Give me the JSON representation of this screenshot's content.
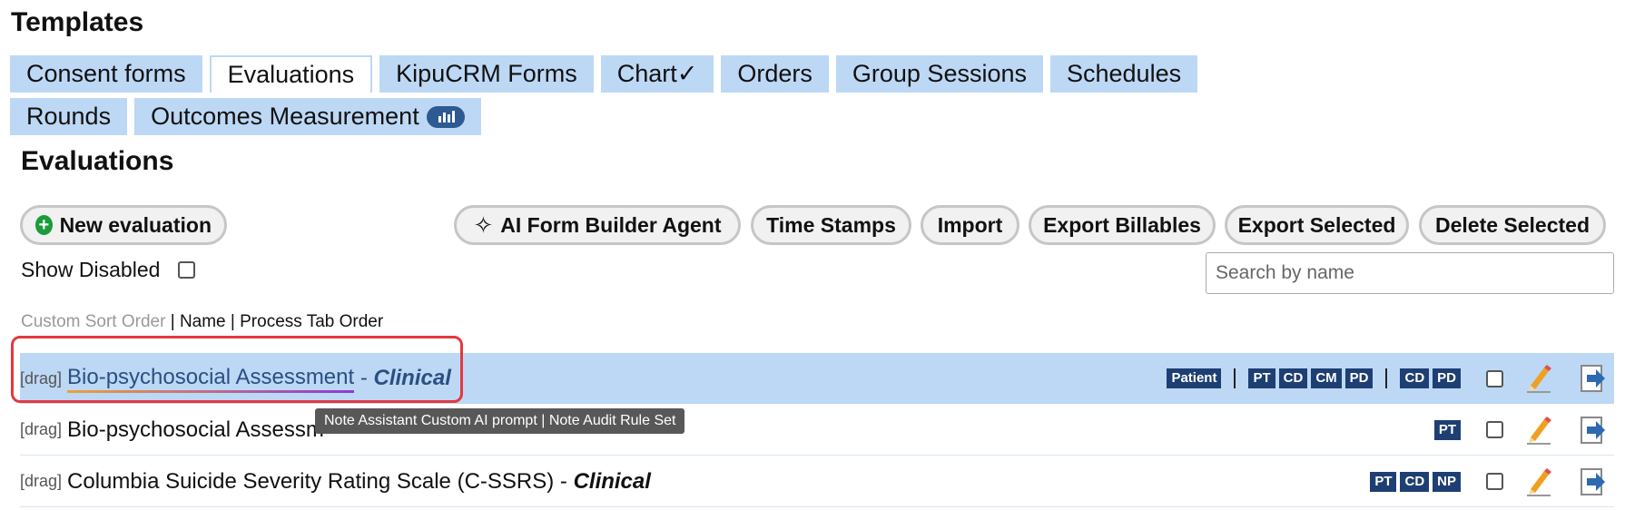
{
  "page": {
    "title": "Templates"
  },
  "tabs": [
    {
      "label": "Consent forms"
    },
    {
      "label": "Evaluations"
    },
    {
      "label": "KipuCRM Forms"
    },
    {
      "label": "Chart✓"
    },
    {
      "label": "Orders"
    },
    {
      "label": "Group Sessions"
    },
    {
      "label": "Schedules"
    },
    {
      "label": "Rounds"
    },
    {
      "label": "Outcomes Measurement"
    }
  ],
  "active_tab": "Evaluations",
  "section": {
    "title": "Evaluations"
  },
  "toolbar": {
    "new_evaluation": "New evaluation",
    "ai_form_builder": "AI Form Builder Agent",
    "time_stamps": "Time Stamps",
    "import": "Import",
    "export_billables": "Export Billables",
    "export_selected": "Export Selected",
    "delete_selected": "Delete Selected"
  },
  "filters": {
    "show_disabled_label": "Show Disabled",
    "show_disabled_checked": false
  },
  "search": {
    "placeholder": "Search by name",
    "value": ""
  },
  "sort": {
    "custom": "Custom Sort Order",
    "separator": " | ",
    "name": "Name",
    "process_tab": "Process Tab Order"
  },
  "rows": [
    {
      "drag": "[drag]",
      "name": "Bio-psychosocial Assessment",
      "category_sep": " - ",
      "category": "Clinical",
      "tag_groups": [
        [
          "Patient"
        ],
        [
          "PT",
          "CD",
          "CM",
          "PD"
        ],
        [
          "CD",
          "PD"
        ]
      ],
      "selected": true,
      "checked": false
    },
    {
      "drag": "[drag]",
      "name": "Bio-psychosocial Assessm",
      "category_sep": "",
      "category": "",
      "tag_groups": [
        [
          "PT"
        ]
      ],
      "selected": false,
      "checked": false
    },
    {
      "drag": "[drag]",
      "name": "Columbia Suicide Severity Rating Scale (C-SSRS)",
      "category_sep": " - ",
      "category": "Clinical",
      "tag_groups": [
        [
          "PT",
          "CD",
          "NP"
        ]
      ],
      "selected": false,
      "checked": false
    }
  ],
  "tooltip": {
    "text": "Note Assistant Custom AI prompt | Note Audit Rule Set"
  },
  "colors": {
    "tab_bg": "#bdd8f5",
    "selected_row": "#bdd8f5",
    "tag_bg": "#1e3f73",
    "highlight": "#e4383f",
    "plus_icon": "#1a9c3a"
  }
}
